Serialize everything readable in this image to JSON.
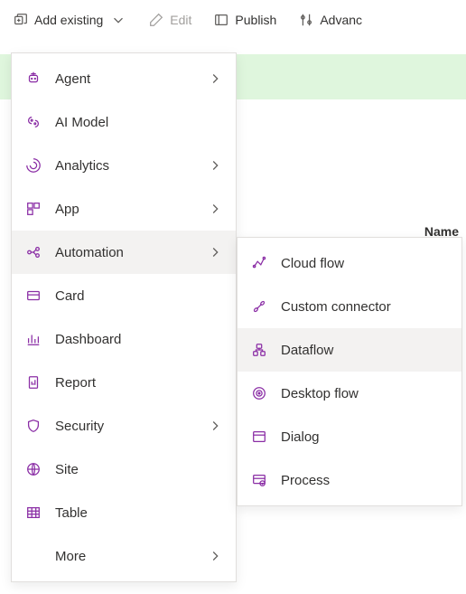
{
  "toolbar": {
    "add_existing": "Add existing",
    "edit": "Edit",
    "publish": "Publish",
    "advanced": "Advanc"
  },
  "menu": {
    "items": [
      {
        "label": "Agent",
        "has_children": true
      },
      {
        "label": "AI Model",
        "has_children": false
      },
      {
        "label": "Analytics",
        "has_children": true
      },
      {
        "label": "App",
        "has_children": true
      },
      {
        "label": "Automation",
        "has_children": true
      },
      {
        "label": "Card",
        "has_children": false
      },
      {
        "label": "Dashboard",
        "has_children": false
      },
      {
        "label": "Report",
        "has_children": false
      },
      {
        "label": "Security",
        "has_children": true
      },
      {
        "label": "Site",
        "has_children": false
      },
      {
        "label": "Table",
        "has_children": false
      },
      {
        "label": "More",
        "has_children": true
      }
    ]
  },
  "submenu": {
    "items": [
      {
        "label": "Cloud flow"
      },
      {
        "label": "Custom connector"
      },
      {
        "label": "Dataflow"
      },
      {
        "label": "Desktop flow"
      },
      {
        "label": "Dialog"
      },
      {
        "label": "Process"
      }
    ]
  },
  "background": {
    "column_header": "Name"
  }
}
